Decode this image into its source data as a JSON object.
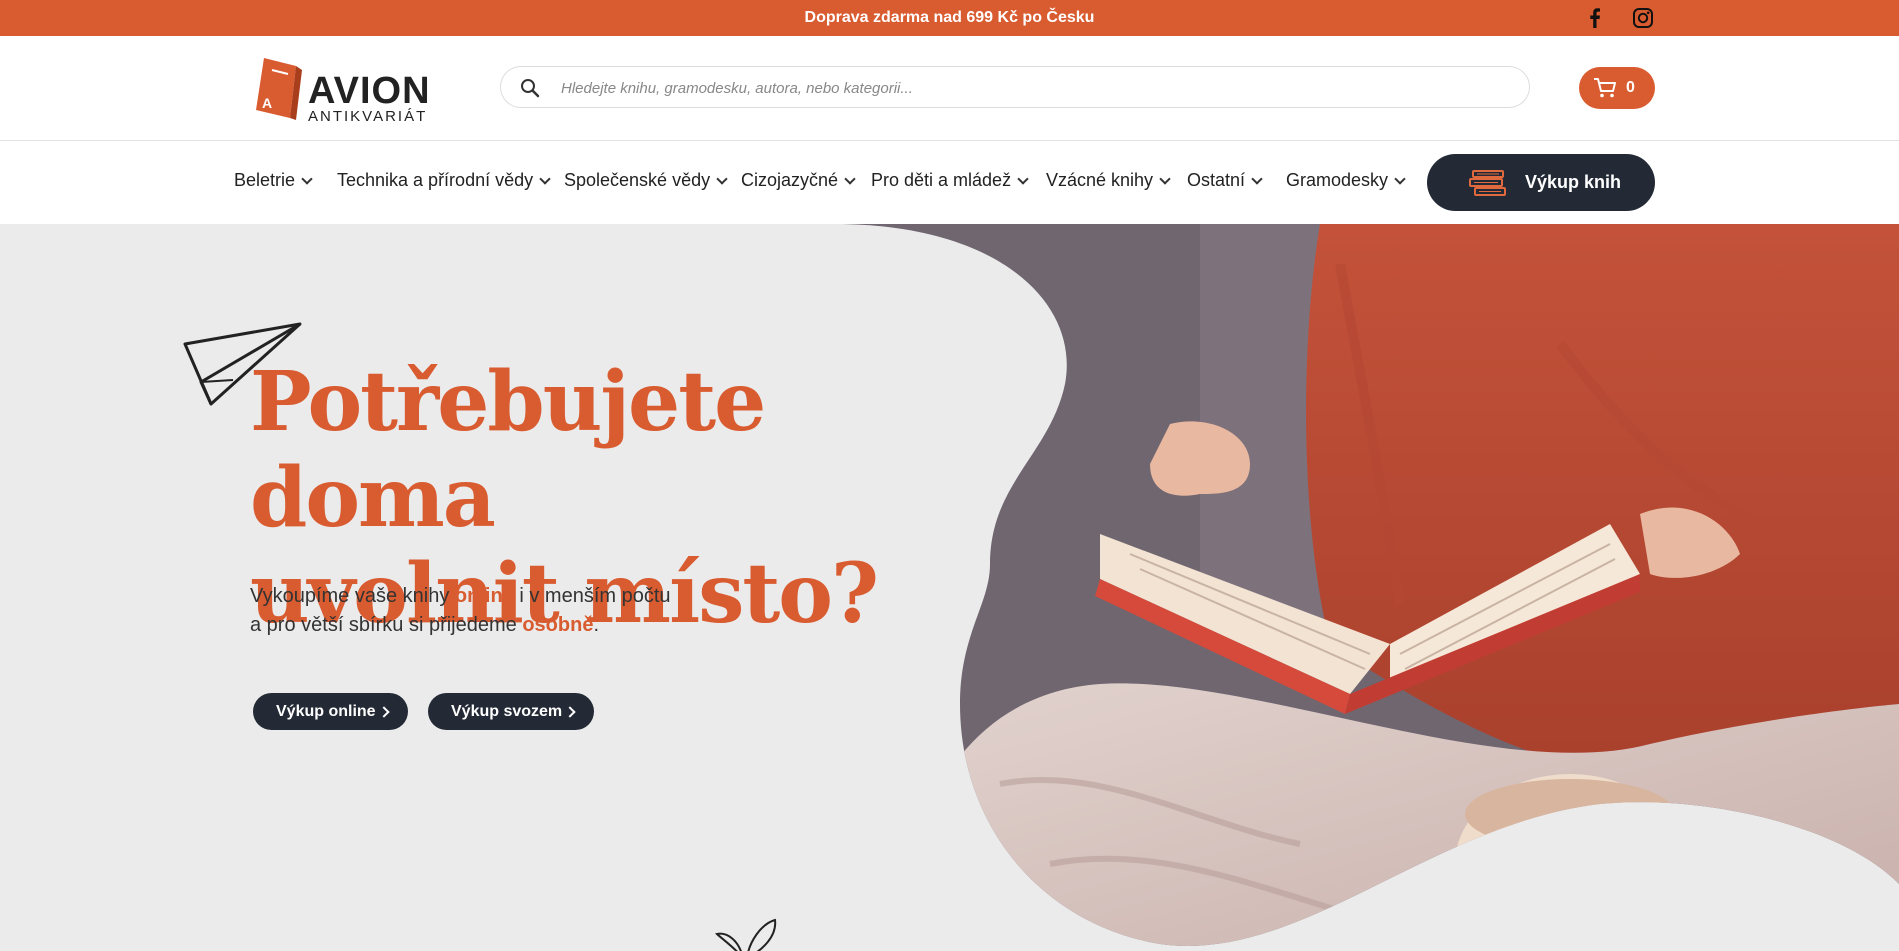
{
  "topbar": {
    "promo": "Doprava zdarma nad 699 Kč po Česku",
    "social": [
      "facebook-icon",
      "instagram-icon"
    ]
  },
  "logo": {
    "name": "AVION",
    "subtitle": "ANTIKVARIÁT"
  },
  "search": {
    "placeholder": "Hledejte knihu, gramodesku, autora, nebo kategorii..."
  },
  "cart": {
    "count": "0"
  },
  "nav": {
    "items": [
      "Beletrie",
      "Technika a přírodní vědy",
      "Společenské vědy",
      "Cizojazyčné",
      "Pro děti a mládež",
      "Vzácné knihy",
      "Ostatní",
      "Gramodesky"
    ],
    "buy_button": "Výkup knih"
  },
  "hero": {
    "title_line1": "Potřebujete doma",
    "title_line2": "uvolnit místo?",
    "text_part1": "Vykoupíme vaše knihy ",
    "text_highlight1": "online",
    "text_part2": " i v menším počtu",
    "text_part3": "a pro větší sbírku si přijedeme ",
    "text_highlight2": "osobně",
    "text_part4": ".",
    "btn_online": "Výkup online",
    "btn_svozem": "Výkup svozem"
  },
  "colors": {
    "accent": "#d95b30",
    "dark": "#232a35",
    "background": "#ebebeb"
  }
}
